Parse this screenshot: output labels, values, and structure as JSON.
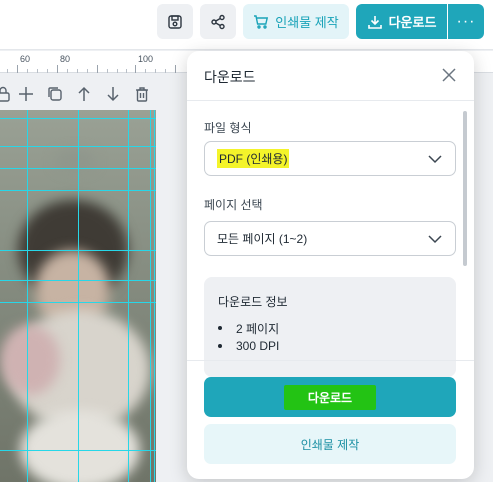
{
  "toolbar": {
    "save_icon": "floppy-disk-icon",
    "share_icon": "share-icon",
    "print_label": "인쇄물 제작",
    "print_icon": "cart-icon",
    "download_label": "다운로드",
    "download_icon": "download-icon",
    "more_label": "···",
    "accent_color": "#1fa6ba"
  },
  "ruler": {
    "labels": [
      "60",
      "80",
      "100"
    ]
  },
  "panel": {
    "title": "다운로드",
    "file_format_label": "파일 형식",
    "file_format_value": "PDF (인쇄용)",
    "page_select_label": "페이지 선택",
    "page_select_value": "모든 페이지 (1~2)",
    "info_title": "다운로드 정보",
    "info_items": [
      "2 페이지",
      "300 DPI"
    ],
    "download_button": "다운로드",
    "print_button": "인쇄물 제작"
  }
}
